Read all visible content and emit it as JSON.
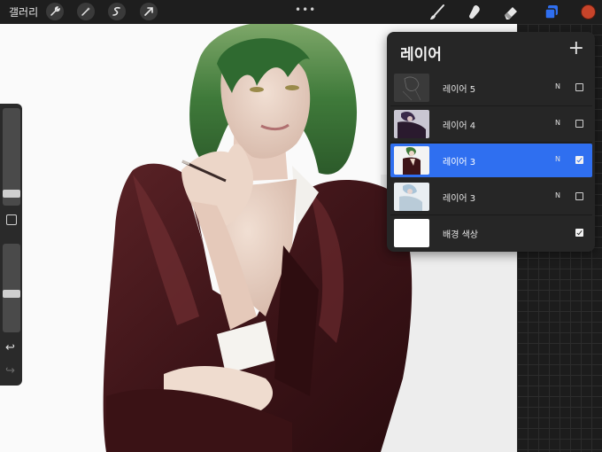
{
  "topbar": {
    "gallery_label": "갤러리",
    "left_tools": [
      "wrench-icon",
      "magic-wand-icon",
      "selection-s-icon",
      "transform-arrow-icon"
    ],
    "more_label": "•••",
    "right_tools": [
      "brush-icon",
      "smudge-icon",
      "eraser-icon",
      "layers-icon"
    ],
    "current_color": "#c8442a"
  },
  "sidebar": {
    "brush_size_level": 0.3,
    "opacity_level": 0.22,
    "modify_button": "square-icon",
    "undo_glyph": "↩",
    "redo_glyph": "↪"
  },
  "layers_panel": {
    "title": "레이어",
    "add_glyph": "+",
    "layers": [
      {
        "name": "레이어 5",
        "mode": "N",
        "visible": false,
        "selected": false,
        "thumb": "sketch-thumbnail"
      },
      {
        "name": "레이어 4",
        "mode": "N",
        "visible": false,
        "selected": false,
        "thumb": "dark-painting-thumbnail"
      },
      {
        "name": "레이어 3",
        "mode": "N",
        "visible": true,
        "selected": true,
        "thumb": "portrait-thumbnail"
      },
      {
        "name": "레이어 3",
        "mode": "N",
        "visible": false,
        "selected": false,
        "thumb": "blue-sketch-thumbnail"
      },
      {
        "name": "배경 색상",
        "mode": "",
        "visible": true,
        "selected": false,
        "thumb": "white-background-thumbnail"
      }
    ]
  },
  "colors": {
    "accent": "#2f6ff0",
    "panel": "#262626",
    "toolbar": "#1e1e1e"
  }
}
